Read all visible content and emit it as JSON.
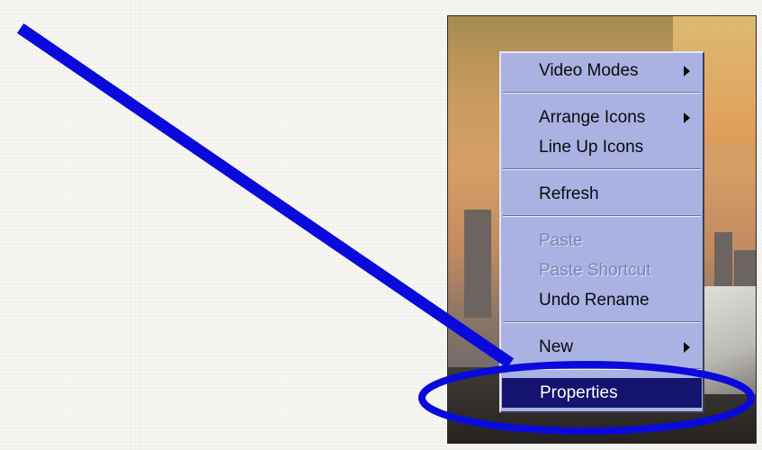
{
  "menu": {
    "items": [
      {
        "label": "Video Modes",
        "submenu": true,
        "enabled": true
      },
      {
        "label": "Arrange Icons",
        "submenu": true,
        "enabled": true
      },
      {
        "label": "Line Up Icons",
        "submenu": false,
        "enabled": true
      },
      {
        "label": "Refresh",
        "submenu": false,
        "enabled": true
      },
      {
        "label": "Paste",
        "submenu": false,
        "enabled": false
      },
      {
        "label": "Paste Shortcut",
        "submenu": false,
        "enabled": false
      },
      {
        "label": "Undo Rename",
        "submenu": false,
        "enabled": true
      },
      {
        "label": "New",
        "submenu": true,
        "enabled": true
      },
      {
        "label": "Properties",
        "submenu": false,
        "enabled": true,
        "selected": true
      }
    ],
    "colors": {
      "background": "#aab2e3",
      "highlight": "#14146e",
      "disabled_text": "#7c83b4"
    }
  },
  "annotation": {
    "color": "#0a0adc",
    "shapes": [
      "pointer-line",
      "highlight-ellipse"
    ]
  }
}
